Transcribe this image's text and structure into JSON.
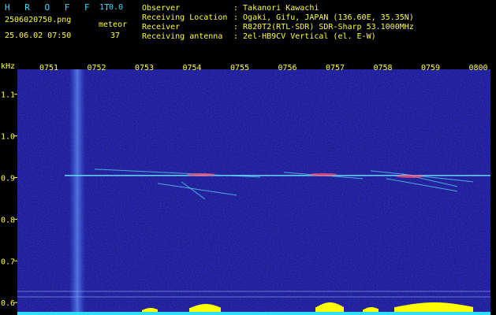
{
  "header": {
    "app_name": "H R O F F T",
    "version": "1.0.0",
    "filename": "2506020750.png",
    "meteor_label": "meteor",
    "meteor_count": "37",
    "datetime": "25.06.02 07:50",
    "fields": [
      {
        "label": "Observer",
        "value": ": Takanori Kawachi"
      },
      {
        "label": "Receiving Location",
        "value": ": Ogaki, Gifu, JAPAN (136.60E, 35.35N)"
      },
      {
        "label": "Receiver",
        "value": ": R820T2(RTL-SDR) SDR-Sharp 53.1000MHz"
      },
      {
        "label": "Receiving antenna",
        "value": ": 2el-HB9CV Vertical (el. E-W)"
      }
    ]
  },
  "chart_data": {
    "type": "heatmap",
    "ylabel": "kHz",
    "x_ticks": [
      "0751",
      "0752",
      "0753",
      "0754",
      "0755",
      "0756",
      "0757",
      "0758",
      "0759",
      "0800"
    ],
    "y_ticks": [
      "1.1",
      "1.0",
      "0.9",
      "0.8",
      "0.7",
      "0.6"
    ],
    "ylim": [
      0.57,
      1.16
    ],
    "carrier_khz": 0.905,
    "colors": {
      "background": "#101070",
      "trace": "#66ddff",
      "highlight": "#ff5577",
      "activity": "#ffff00",
      "baseline": "#33ddff"
    }
  }
}
